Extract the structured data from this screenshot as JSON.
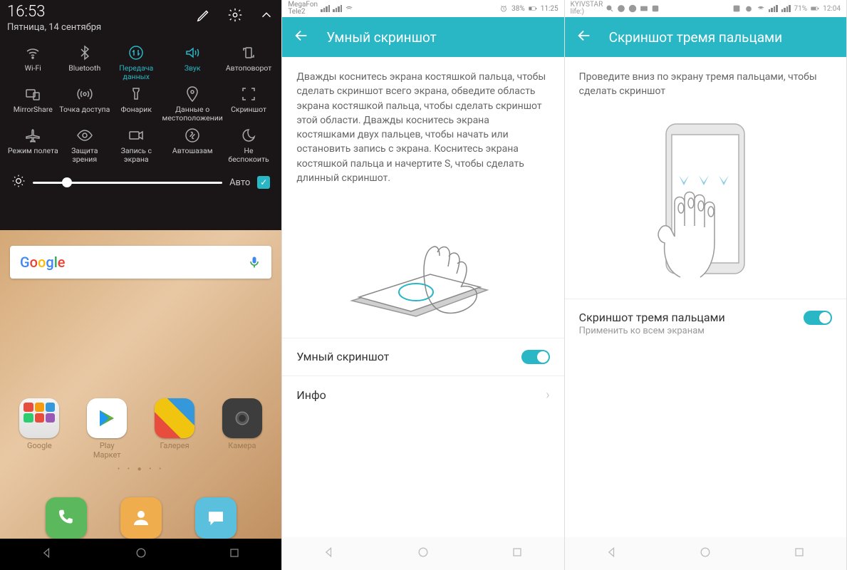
{
  "phone1": {
    "time": "16:53",
    "date": "Пятница, 14 сентября",
    "tiles": [
      {
        "label": "Wi-Fi"
      },
      {
        "label": "Bluetooth"
      },
      {
        "label": "Передача данных",
        "active": true
      },
      {
        "label": "Звук",
        "active": true
      },
      {
        "label": "Автоповорот"
      },
      {
        "label": "MirrorShare"
      },
      {
        "label": "Точка доступа"
      },
      {
        "label": "Фонарик"
      },
      {
        "label": "Данные о местоположении"
      },
      {
        "label": "Скриншот"
      },
      {
        "label": "Режим полета"
      },
      {
        "label": "Защита зрения"
      },
      {
        "label": "Запись с экрана"
      },
      {
        "label": "Автошазам"
      },
      {
        "label": "Не беспокоить"
      }
    ],
    "brightness": {
      "auto_label": "Авто",
      "auto_checked": true,
      "level_pct": 18
    },
    "apps": [
      {
        "label": "Google"
      },
      {
        "label": "Play Маркет"
      },
      {
        "label": "Галерея"
      },
      {
        "label": "Камера"
      }
    ]
  },
  "phone2": {
    "status": {
      "carrier1": "MegaFon",
      "carrier2": "Tele2",
      "battery": "38%",
      "time": "11:25"
    },
    "title": "Умный скриншот",
    "description": "Дважды коснитесь экрана костяшкой пальца, чтобы сделать скриншот всего экрана, обведите область экрана костяшкой пальца, чтобы сделать скриншот этой области. Дважды коснитесь экрана костяшками двух пальцев, чтобы начать или остановить запись с экрана. Коснитесь экрана костяшкой пальца и начертите S, чтобы сделать длинный скриншот.",
    "row_toggle": "Умный скриншот",
    "row_info": "Инфо"
  },
  "phone3": {
    "status": {
      "carrier": "KYIVSTAR",
      "carrier2": "life:)",
      "battery": "71%",
      "time": "12:04"
    },
    "title": "Скриншот тремя пальцами",
    "description": "Проведите вниз по экрану тремя пальцами, чтобы сделать скриншот",
    "row_title": "Скриншот тремя пальцами",
    "row_sub": "Применить ко всем экранам"
  }
}
